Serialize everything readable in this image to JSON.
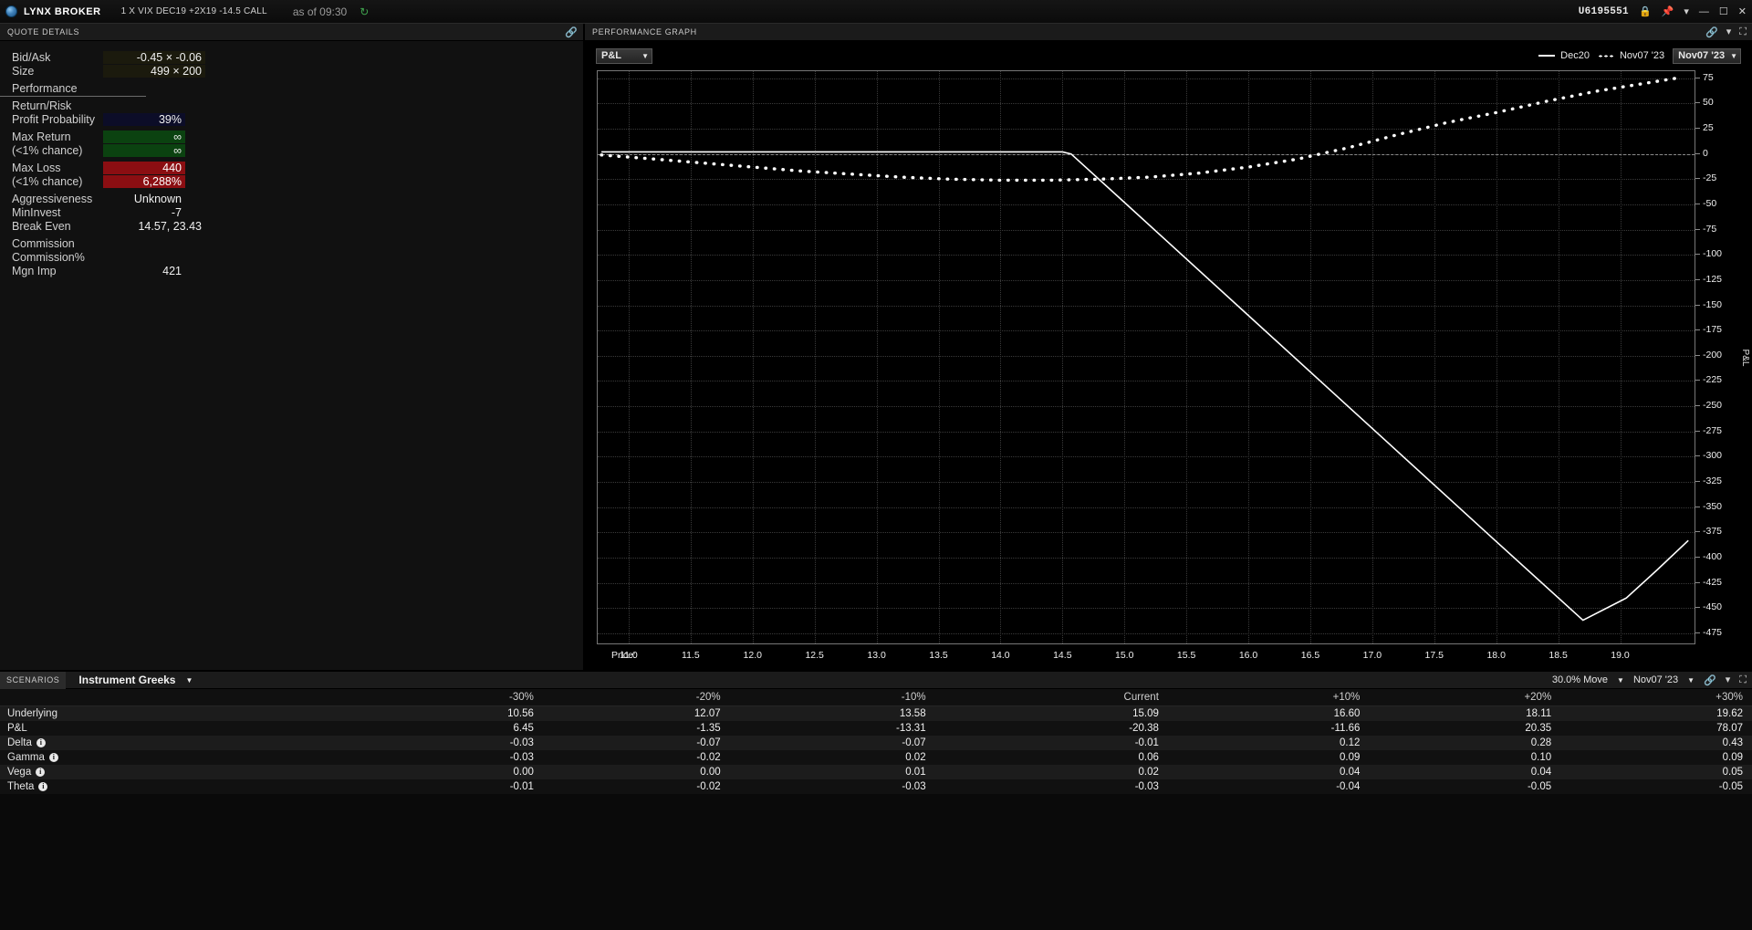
{
  "titlebar": {
    "brand": "LYNX BROKER",
    "contract": "1 X VIX DEC19  +2X19  -14.5 CALL",
    "asof": "as of 09:30",
    "refresh_icon": "refresh-icon",
    "account": "U6195551",
    "lock_icon": "lock-icon",
    "pin_icon": "pin-icon",
    "caret_icon": "chevron-down-icon",
    "minimize_icon": "minimize-icon",
    "restore_icon": "restore-icon",
    "close_icon": "close-icon"
  },
  "quote_details": {
    "title": "QUOTE DETAILS",
    "link_icon": "link-icon",
    "rows": [
      {
        "label": "Bid/Ask",
        "value": "-0.45 × -0.06",
        "style": "olive"
      },
      {
        "label": "Size",
        "value": "499 × 200",
        "style": "olive"
      }
    ],
    "section": "Performance",
    "perf": [
      {
        "label": "Return/Risk",
        "value": "",
        "style": "navy"
      },
      {
        "label": "Profit Probability",
        "value": "39%",
        "style": "navy"
      },
      {
        "label": "Max Return",
        "value": "∞",
        "style": "green"
      },
      {
        "label": "(<1% chance)",
        "value": "∞",
        "style": "green"
      },
      {
        "label": "Max Loss",
        "value": "440",
        "style": "red"
      },
      {
        "label": "(<1% chance)",
        "value": "6,288%",
        "style": "red"
      },
      {
        "label": "Aggressiveness",
        "value": "Unknown",
        "style": "none"
      },
      {
        "label": "MinInvest",
        "value": "-7",
        "style": "none"
      },
      {
        "label": "Break Even",
        "value": "14.57, 23.43",
        "style": "none"
      },
      {
        "label": "Commission",
        "value": "",
        "style": "none"
      },
      {
        "label": "Commission%",
        "value": "",
        "style": "none"
      },
      {
        "label": "Mgn Imp",
        "value": "421",
        "style": "none"
      }
    ]
  },
  "graph": {
    "title": "PERFORMANCE GRAPH",
    "link_icon": "link-icon",
    "caret_icon": "chevron-down-icon",
    "expand_icon": "expand-icon",
    "metric_select": "P&L",
    "legend": [
      {
        "label": "Dec20",
        "style": "solid"
      },
      {
        "label": "Nov07 '23",
        "style": "dotted"
      }
    ],
    "date_select": "Nov07 '23"
  },
  "chart_data": {
    "type": "line",
    "title": "PERFORMANCE GRAPH",
    "xlabel": "Price:",
    "ylabel": "P&L",
    "xlim": [
      10.75,
      19.6
    ],
    "ylim": [
      -485,
      82
    ],
    "grid": true,
    "legend_position": "top-right",
    "x_ticks": [
      "11.0",
      "11.5",
      "12.0",
      "12.5",
      "13.0",
      "13.5",
      "14.0",
      "14.5",
      "15.0",
      "15.5",
      "16.0",
      "16.5",
      "17.0",
      "17.5",
      "18.0",
      "18.5",
      "19.0"
    ],
    "x_tick_values": [
      11.0,
      11.5,
      12.0,
      12.5,
      13.0,
      13.5,
      14.0,
      14.5,
      15.0,
      15.5,
      16.0,
      16.5,
      17.0,
      17.5,
      18.0,
      18.5,
      19.0
    ],
    "y_ticks": [
      "75",
      "50",
      "25",
      "0",
      "-25",
      "-50",
      "-75",
      "-100",
      "-125",
      "-150",
      "-175",
      "-200",
      "-225",
      "-250",
      "-275",
      "-300",
      "-325",
      "-350",
      "-375",
      "-400",
      "-425",
      "-450",
      "-475"
    ],
    "y_tick_values": [
      75,
      50,
      25,
      0,
      -25,
      -50,
      -75,
      -100,
      -125,
      -150,
      -175,
      -200,
      -225,
      -250,
      -275,
      -300,
      -325,
      -350,
      -375,
      -400,
      -425,
      -450,
      -475
    ],
    "series": [
      {
        "name": "Dec20",
        "style": "solid",
        "color": "#ffffff",
        "x": [
          10.78,
          12.0,
          13.0,
          14.0,
          14.5,
          14.57,
          15.0,
          16.0,
          17.0,
          18.0,
          18.7,
          19.05,
          19.3,
          19.55
        ],
        "y": [
          2,
          2,
          2,
          2,
          2,
          0,
          -48,
          -160,
          -272,
          -384,
          -462,
          -440,
          -412,
          -383
        ]
      },
      {
        "name": "Nov07 '23",
        "style": "dotted",
        "color": "#ffffff",
        "x": [
          10.78,
          11.2,
          11.6,
          12.0,
          12.4,
          12.8,
          13.2,
          13.6,
          14.0,
          14.4,
          14.8,
          15.2,
          15.6,
          16.0,
          16.4,
          16.8,
          17.2,
          17.6,
          18.0,
          18.4,
          18.8,
          19.2,
          19.5
        ],
        "y": [
          -1,
          -5,
          -9,
          -13,
          -17,
          -20,
          -23,
          -25,
          -26,
          -26,
          -25,
          -23,
          -19,
          -13,
          -5,
          6,
          19,
          31,
          41,
          52,
          62,
          70,
          76
        ]
      }
    ]
  },
  "scenarios": {
    "tab": "SCENARIOS",
    "greeks_select": "Instrument Greeks",
    "move_select": "30.0% Move",
    "date_select": "Nov07 '23",
    "link_icon": "link-icon",
    "caret_icon": "chevron-down-icon",
    "expand_icon": "expand-icon",
    "columns": [
      "",
      "-30%",
      "-20%",
      "-10%",
      "Current",
      "+10%",
      "+20%",
      "+30%"
    ],
    "rows": [
      {
        "label": "Underlying",
        "info": false,
        "values": [
          "10.56",
          "12.07",
          "13.58",
          "15.09",
          "16.60",
          "18.11",
          "19.62"
        ]
      },
      {
        "label": "P&L",
        "info": false,
        "values": [
          "6.45",
          "-1.35",
          "-13.31",
          "-20.38",
          "-11.66",
          "20.35",
          "78.07"
        ]
      },
      {
        "label": "Delta",
        "info": true,
        "values": [
          "-0.03",
          "-0.07",
          "-0.07",
          "-0.01",
          "0.12",
          "0.28",
          "0.43"
        ]
      },
      {
        "label": "Gamma",
        "info": true,
        "values": [
          "-0.03",
          "-0.02",
          "0.02",
          "0.06",
          "0.09",
          "0.10",
          "0.09"
        ]
      },
      {
        "label": "Vega",
        "info": true,
        "values": [
          "0.00",
          "0.00",
          "0.01",
          "0.02",
          "0.04",
          "0.04",
          "0.05"
        ]
      },
      {
        "label": "Theta",
        "info": true,
        "values": [
          "-0.01",
          "-0.02",
          "-0.03",
          "-0.03",
          "-0.04",
          "-0.05",
          "-0.05"
        ]
      }
    ]
  }
}
